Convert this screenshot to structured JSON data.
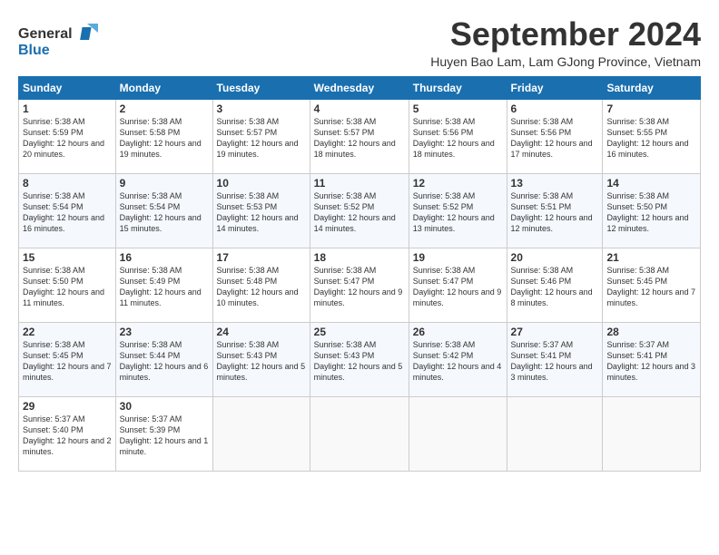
{
  "logo": {
    "line1": "General",
    "line2": "Blue"
  },
  "title": "September 2024",
  "subtitle": "Huyen Bao Lam, Lam GJong Province, Vietnam",
  "weekdays": [
    "Sunday",
    "Monday",
    "Tuesday",
    "Wednesday",
    "Thursday",
    "Friday",
    "Saturday"
  ],
  "weeks": [
    [
      {
        "day": "1",
        "sunrise": "Sunrise: 5:38 AM",
        "sunset": "Sunset: 5:59 PM",
        "daylight": "Daylight: 12 hours and 20 minutes."
      },
      {
        "day": "2",
        "sunrise": "Sunrise: 5:38 AM",
        "sunset": "Sunset: 5:58 PM",
        "daylight": "Daylight: 12 hours and 19 minutes."
      },
      {
        "day": "3",
        "sunrise": "Sunrise: 5:38 AM",
        "sunset": "Sunset: 5:57 PM",
        "daylight": "Daylight: 12 hours and 19 minutes."
      },
      {
        "day": "4",
        "sunrise": "Sunrise: 5:38 AM",
        "sunset": "Sunset: 5:57 PM",
        "daylight": "Daylight: 12 hours and 18 minutes."
      },
      {
        "day": "5",
        "sunrise": "Sunrise: 5:38 AM",
        "sunset": "Sunset: 5:56 PM",
        "daylight": "Daylight: 12 hours and 18 minutes."
      },
      {
        "day": "6",
        "sunrise": "Sunrise: 5:38 AM",
        "sunset": "Sunset: 5:56 PM",
        "daylight": "Daylight: 12 hours and 17 minutes."
      },
      {
        "day": "7",
        "sunrise": "Sunrise: 5:38 AM",
        "sunset": "Sunset: 5:55 PM",
        "daylight": "Daylight: 12 hours and 16 minutes."
      }
    ],
    [
      {
        "day": "8",
        "sunrise": "Sunrise: 5:38 AM",
        "sunset": "Sunset: 5:54 PM",
        "daylight": "Daylight: 12 hours and 16 minutes."
      },
      {
        "day": "9",
        "sunrise": "Sunrise: 5:38 AM",
        "sunset": "Sunset: 5:54 PM",
        "daylight": "Daylight: 12 hours and 15 minutes."
      },
      {
        "day": "10",
        "sunrise": "Sunrise: 5:38 AM",
        "sunset": "Sunset: 5:53 PM",
        "daylight": "Daylight: 12 hours and 14 minutes."
      },
      {
        "day": "11",
        "sunrise": "Sunrise: 5:38 AM",
        "sunset": "Sunset: 5:52 PM",
        "daylight": "Daylight: 12 hours and 14 minutes."
      },
      {
        "day": "12",
        "sunrise": "Sunrise: 5:38 AM",
        "sunset": "Sunset: 5:52 PM",
        "daylight": "Daylight: 12 hours and 13 minutes."
      },
      {
        "day": "13",
        "sunrise": "Sunrise: 5:38 AM",
        "sunset": "Sunset: 5:51 PM",
        "daylight": "Daylight: 12 hours and 12 minutes."
      },
      {
        "day": "14",
        "sunrise": "Sunrise: 5:38 AM",
        "sunset": "Sunset: 5:50 PM",
        "daylight": "Daylight: 12 hours and 12 minutes."
      }
    ],
    [
      {
        "day": "15",
        "sunrise": "Sunrise: 5:38 AM",
        "sunset": "Sunset: 5:50 PM",
        "daylight": "Daylight: 12 hours and 11 minutes."
      },
      {
        "day": "16",
        "sunrise": "Sunrise: 5:38 AM",
        "sunset": "Sunset: 5:49 PM",
        "daylight": "Daylight: 12 hours and 11 minutes."
      },
      {
        "day": "17",
        "sunrise": "Sunrise: 5:38 AM",
        "sunset": "Sunset: 5:48 PM",
        "daylight": "Daylight: 12 hours and 10 minutes."
      },
      {
        "day": "18",
        "sunrise": "Sunrise: 5:38 AM",
        "sunset": "Sunset: 5:47 PM",
        "daylight": "Daylight: 12 hours and 9 minutes."
      },
      {
        "day": "19",
        "sunrise": "Sunrise: 5:38 AM",
        "sunset": "Sunset: 5:47 PM",
        "daylight": "Daylight: 12 hours and 9 minutes."
      },
      {
        "day": "20",
        "sunrise": "Sunrise: 5:38 AM",
        "sunset": "Sunset: 5:46 PM",
        "daylight": "Daylight: 12 hours and 8 minutes."
      },
      {
        "day": "21",
        "sunrise": "Sunrise: 5:38 AM",
        "sunset": "Sunset: 5:45 PM",
        "daylight": "Daylight: 12 hours and 7 minutes."
      }
    ],
    [
      {
        "day": "22",
        "sunrise": "Sunrise: 5:38 AM",
        "sunset": "Sunset: 5:45 PM",
        "daylight": "Daylight: 12 hours and 7 minutes."
      },
      {
        "day": "23",
        "sunrise": "Sunrise: 5:38 AM",
        "sunset": "Sunset: 5:44 PM",
        "daylight": "Daylight: 12 hours and 6 minutes."
      },
      {
        "day": "24",
        "sunrise": "Sunrise: 5:38 AM",
        "sunset": "Sunset: 5:43 PM",
        "daylight": "Daylight: 12 hours and 5 minutes."
      },
      {
        "day": "25",
        "sunrise": "Sunrise: 5:38 AM",
        "sunset": "Sunset: 5:43 PM",
        "daylight": "Daylight: 12 hours and 5 minutes."
      },
      {
        "day": "26",
        "sunrise": "Sunrise: 5:38 AM",
        "sunset": "Sunset: 5:42 PM",
        "daylight": "Daylight: 12 hours and 4 minutes."
      },
      {
        "day": "27",
        "sunrise": "Sunrise: 5:37 AM",
        "sunset": "Sunset: 5:41 PM",
        "daylight": "Daylight: 12 hours and 3 minutes."
      },
      {
        "day": "28",
        "sunrise": "Sunrise: 5:37 AM",
        "sunset": "Sunset: 5:41 PM",
        "daylight": "Daylight: 12 hours and 3 minutes."
      }
    ],
    [
      {
        "day": "29",
        "sunrise": "Sunrise: 5:37 AM",
        "sunset": "Sunset: 5:40 PM",
        "daylight": "Daylight: 12 hours and 2 minutes."
      },
      {
        "day": "30",
        "sunrise": "Sunrise: 5:37 AM",
        "sunset": "Sunset: 5:39 PM",
        "daylight": "Daylight: 12 hours and 1 minute."
      },
      null,
      null,
      null,
      null,
      null
    ]
  ]
}
